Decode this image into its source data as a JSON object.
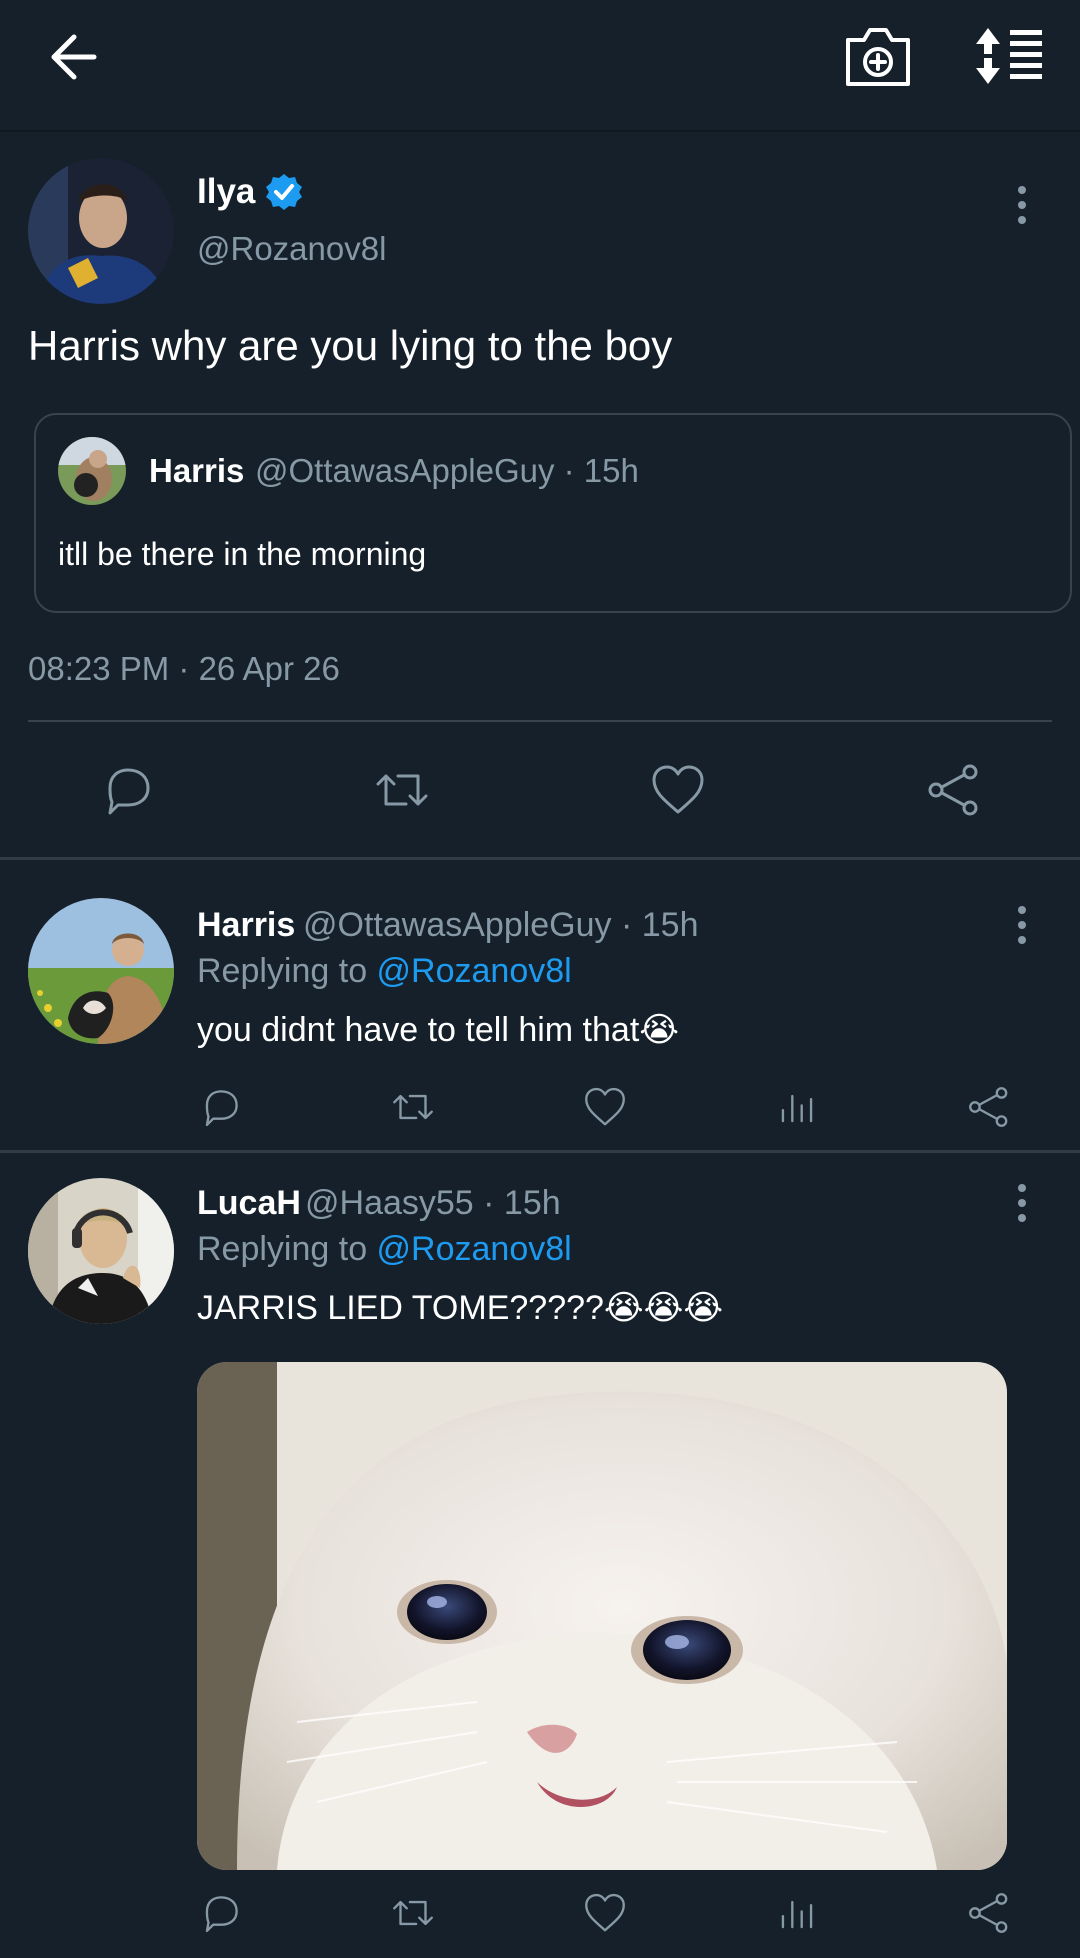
{
  "main_tweet": {
    "author_name": "Ilya",
    "handle": "@Rozanov8l",
    "text": "Harris why are you lying to the boy",
    "quote": {
      "author_name": "Harris",
      "meta": "@OttawasAppleGuy · 15h",
      "text": "itll be there in the morning"
    },
    "timestamp": "08:23 PM · 26 Apr 26"
  },
  "replies": [
    {
      "author_name": "Harris",
      "meta": "@OttawasAppleGuy · 15h",
      "replying_prefix": "Replying to ",
      "replying_handle": "@Rozanov8l",
      "text": "you didnt have to tell him that😭"
    },
    {
      "author_name": "LucaH",
      "meta": "@Haasy55 · 15h",
      "replying_prefix": "Replying to ",
      "replying_handle": "@Rozanov8l",
      "text": "JARRIS LIED TOME?????😭😭😭"
    }
  ],
  "icons": {
    "back": "arrow-left-icon",
    "camera": "camera-plus-icon",
    "sort": "sort-list-icon",
    "reply": "reply-icon",
    "retweet": "retweet-icon",
    "like": "heart-icon",
    "analytics": "analytics-icon",
    "share": "share-icon",
    "more": "more-vertical-icon",
    "verified": "verified-badge-icon"
  },
  "colors": {
    "background": "#15202b",
    "secondary_text": "#8899a6",
    "accent": "#1d9bf0",
    "divider": "#38444d"
  }
}
